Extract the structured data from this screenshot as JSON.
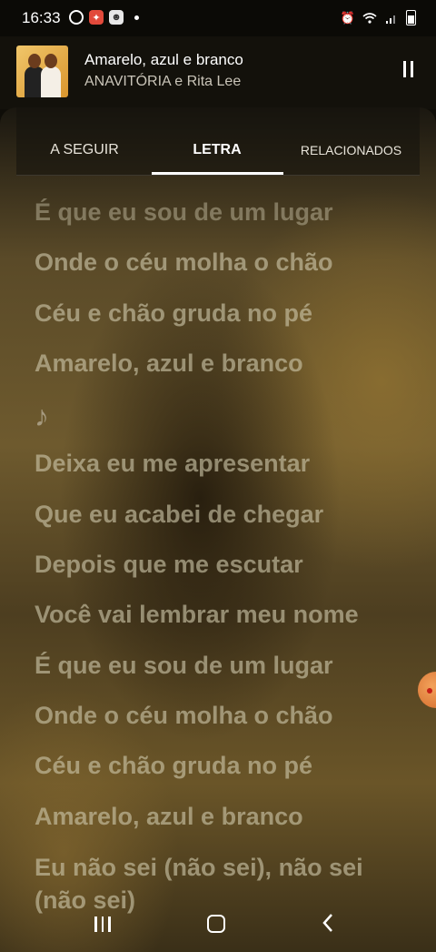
{
  "status_bar": {
    "time": "16:33",
    "left_icons": [
      "whatsapp-icon",
      "app-red-icon",
      "app-grey-icon",
      "notification-dot"
    ],
    "right_icons": [
      "alarm-icon",
      "wifi-icon",
      "signal-icon",
      "battery-icon"
    ]
  },
  "player": {
    "title": "Amarelo, azul e branco",
    "artist": "ANAVITÓRIA e Rita Lee",
    "state": "playing"
  },
  "tabs": [
    {
      "label": "A SEGUIR",
      "active": false
    },
    {
      "label": "LETRA",
      "active": true
    },
    {
      "label": "RELACIONADOS",
      "active": false
    }
  ],
  "lyrics": {
    "lines": [
      "É que eu sou de um lugar",
      "Onde o céu molha o chão",
      "Céu e chão gruda no pé",
      "Amarelo, azul e branco",
      "♪",
      "Deixa eu me apresentar",
      "Que eu acabei de chegar",
      "Depois que me escutar",
      "Você vai lembrar meu nome",
      "É que eu sou de um lugar",
      "Onde o céu molha o chão",
      "Céu e chão gruda no pé",
      "Amarelo, azul e branco",
      "Eu não sei (não sei), não sei (não sei)"
    ]
  },
  "colors": {
    "lyric_text": "#cdc6aa",
    "accent": "#ffffff",
    "handle": "#e07a33"
  }
}
